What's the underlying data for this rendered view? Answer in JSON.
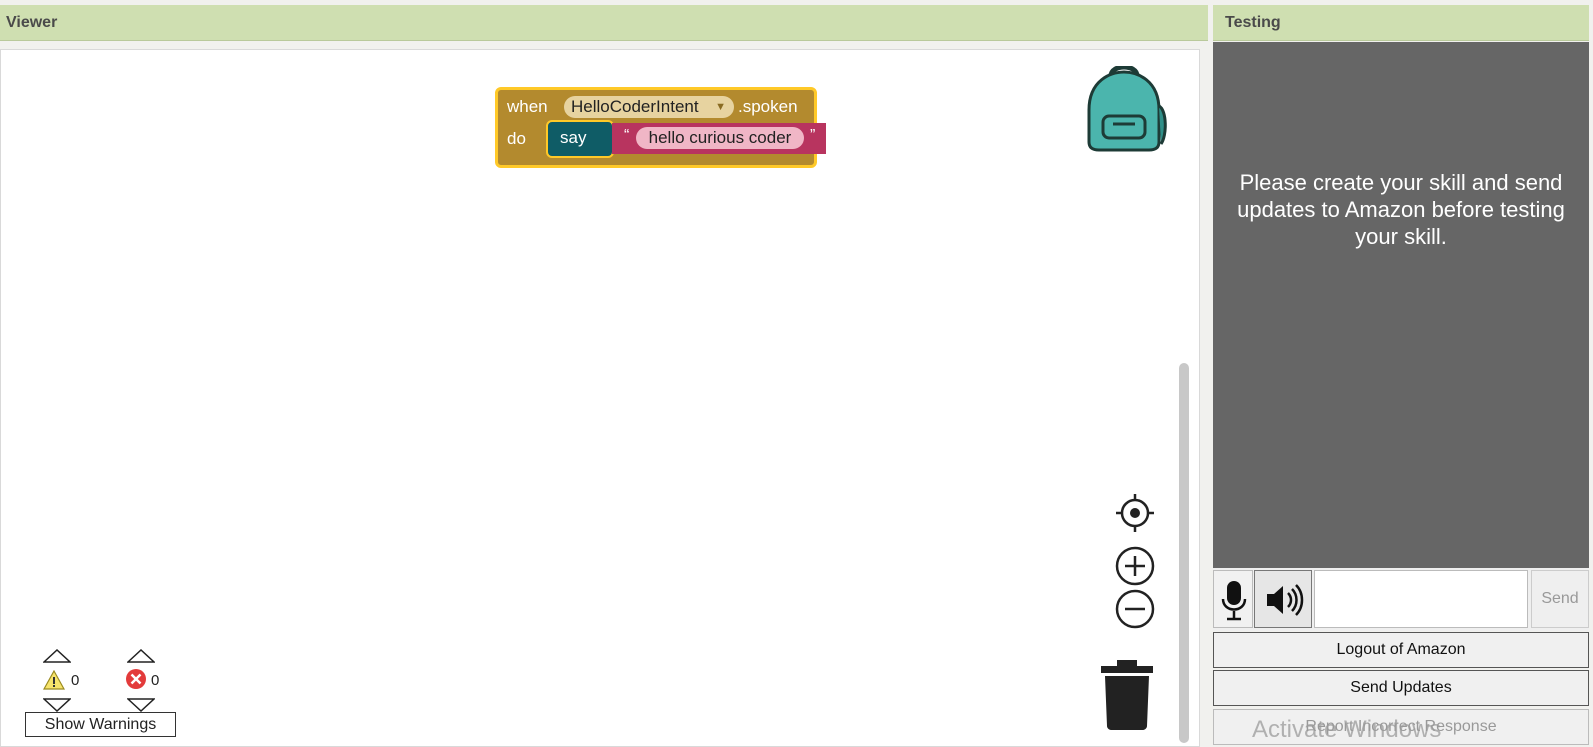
{
  "viewer": {
    "title": "Viewer",
    "blocks": {
      "event_when": "when",
      "intent_name": "HelloCoderIntent",
      "event_suffix": ".spoken",
      "do_label": "do",
      "say_label": "say",
      "open_quote": "“",
      "text_value": "hello curious coder",
      "close_quote": "”"
    },
    "warnings": {
      "warning_count": "0",
      "error_count": "0",
      "show_warnings_label": "Show Warnings"
    }
  },
  "testing": {
    "title": "Testing",
    "message": "Please create your skill and send updates to Amazon before testing your skill.",
    "input_value": "",
    "send_label": "Send",
    "logout_label": "Logout of Amazon",
    "send_updates_label": "Send Updates",
    "report_label": "Report Incorrect Response"
  },
  "watermark": "Activate Windows",
  "colors": {
    "header_bg": "#cfdfb1",
    "event_block": "#b38a2e",
    "block_highlight": "#ffc928",
    "say_block": "#0f5c66",
    "text_block": "#b8345f",
    "testing_bg": "#666666"
  },
  "icons": [
    "backpack-icon",
    "center-target-icon",
    "zoom-in-icon",
    "zoom-out-icon",
    "trash-icon",
    "warning-icon",
    "error-icon",
    "microphone-icon",
    "speaker-icon"
  ]
}
